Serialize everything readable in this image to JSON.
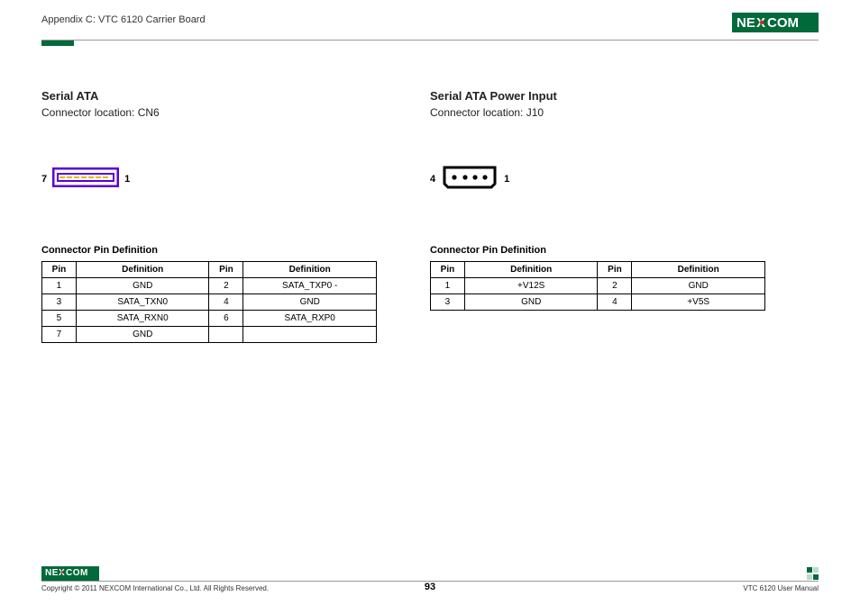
{
  "header": {
    "appendix": "Appendix C: VTC 6120 Carrier Board",
    "brand": "NEXCOM"
  },
  "left": {
    "title": "Serial ATA",
    "location": "Connector location: CN6",
    "pin_left": "7",
    "pin_right": "1",
    "table_title": "Connector Pin Definition",
    "headers": {
      "pin": "Pin",
      "def": "Definition"
    },
    "rows": [
      {
        "p1": "1",
        "d1": "GND",
        "p2": "2",
        "d2": "SATA_TXP0 -"
      },
      {
        "p1": "3",
        "d1": "SATA_TXN0",
        "p2": "4",
        "d2": "GND"
      },
      {
        "p1": "5",
        "d1": "SATA_RXN0",
        "p2": "6",
        "d2": "SATA_RXP0"
      },
      {
        "p1": "7",
        "d1": "GND",
        "p2": "",
        "d2": ""
      }
    ]
  },
  "right": {
    "title": "Serial ATA Power Input",
    "location": "Connector location: J10",
    "pin_left": "4",
    "pin_right": "1",
    "table_title": "Connector Pin Definition",
    "headers": {
      "pin": "Pin",
      "def": "Definition"
    },
    "rows": [
      {
        "p1": "1",
        "d1": "+V12S",
        "p2": "2",
        "d2": "GND"
      },
      {
        "p1": "3",
        "d1": "GND",
        "p2": "4",
        "d2": "+V5S"
      }
    ]
  },
  "footer": {
    "brand": "NEXCOM",
    "copyright": "Copyright © 2011 NEXCOM International Co., Ltd. All Rights Reserved.",
    "page": "93",
    "manual": "VTC 6120 User Manual"
  }
}
